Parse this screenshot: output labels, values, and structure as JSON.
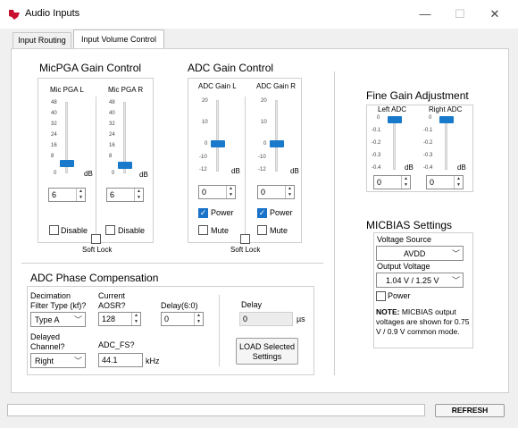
{
  "window": {
    "title": "Audio Inputs",
    "minimize": "—",
    "maximize": "☐",
    "close": "✕"
  },
  "tabs": [
    {
      "label": "Input Routing"
    },
    {
      "label": "Input Volume Control"
    }
  ],
  "micpga": {
    "title": "MicPGA Gain Control",
    "scale": [
      "48",
      "40",
      "32",
      "24",
      "16",
      "8",
      "0"
    ],
    "left": {
      "label": "Mic PGA L",
      "value": "6",
      "disable": "Disable",
      "level": 0.125
    },
    "right": {
      "label": "Mic PGA R",
      "value": "6",
      "disable": "Disable",
      "level": 0.125
    },
    "db": "dB",
    "softlock": "Soft Lock"
  },
  "adc": {
    "title": "ADC Gain Control",
    "scale": [
      "20",
      "10",
      "0",
      "-10",
      "-12"
    ],
    "left": {
      "label": "ADC Gain L",
      "value": "0",
      "power": "Power",
      "mute": "Mute",
      "level": 0.375
    },
    "right": {
      "label": "ADC Gain R",
      "value": "0",
      "power": "Power",
      "mute": "Mute",
      "level": 0.375
    },
    "db": "dB",
    "softlock": "Soft Lock"
  },
  "fine": {
    "title": "Fine Gain Adjustment",
    "scale": [
      "0",
      "-0.1",
      "-0.2",
      "-0.3",
      "-0.4"
    ],
    "left": {
      "label": "Left ADC",
      "value": "0"
    },
    "right": {
      "label": "Right ADC",
      "value": "0"
    },
    "db": "dB"
  },
  "micbias": {
    "title": "MICBIAS Settings",
    "voltage_source_label": "Voltage Source",
    "voltage_source": "AVDD",
    "output_voltage_label": "Output Voltage",
    "output_voltage": "1.04 V / 1.25 V",
    "power": "Power",
    "note_bold": "NOTE:",
    "note_text": "MICBIAS output voltages are shown for 0.75 V / 0.9 V common mode."
  },
  "phase": {
    "title": "ADC Phase Compensation",
    "decimation_label1": "Decimation",
    "decimation_label2": "Filter Type (kf)?",
    "decimation_value": "Type A",
    "aosr_label1": "Current",
    "aosr_label2": "AOSR?",
    "aosr_value": "128",
    "delay60_label": "Delay(6:0)",
    "delay60_value": "0",
    "delayed_label1": "Delayed",
    "delayed_label2": "Channel?",
    "delayed_value": "Right",
    "adcfs_label": "ADC_FS?",
    "adcfs_value": "44.1",
    "khz": "kHz",
    "delay_label": "Delay",
    "delay_value": "0",
    "us": "µs",
    "load_line1": "LOAD Selected",
    "load_line2": "Settings"
  },
  "footer": {
    "refresh": "REFRESH",
    "status": ""
  }
}
